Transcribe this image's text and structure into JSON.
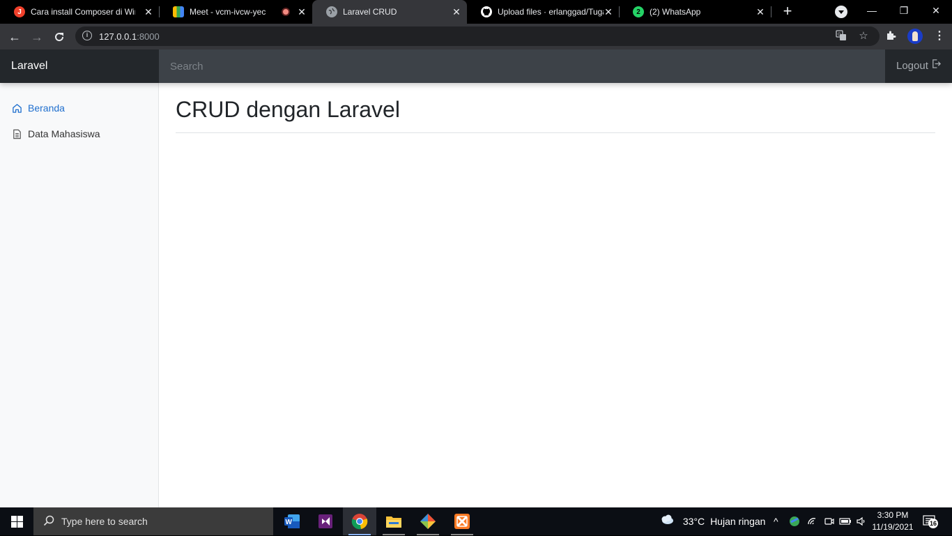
{
  "browser": {
    "tabs": [
      {
        "title": "Cara install Composer di Wind",
        "favicon": "jotform-icon",
        "color": "#f1402b",
        "glyph": "J"
      },
      {
        "title": "Meet - vcm-ivcw-yec",
        "favicon": "google-meet-icon",
        "color": "#00832d",
        "glyph": "■"
      },
      {
        "title": "Laravel CRUD",
        "favicon": "globe-icon",
        "color": "#9aa0a6",
        "glyph": "●"
      },
      {
        "title": "Upload files · erlanggad/Tuga",
        "favicon": "github-icon",
        "color": "#ffffff",
        "glyph": "●"
      },
      {
        "title": "(2) WhatsApp",
        "favicon": "whatsapp-icon",
        "color": "#25d366",
        "glyph": "2"
      }
    ],
    "url_host": "127.0.0.1",
    "url_port": ":8000"
  },
  "app": {
    "brand": "Laravel",
    "search_placeholder": "Search",
    "logout_label": "Logout",
    "sidebar": [
      {
        "label": "Beranda",
        "icon": "home-icon",
        "active": true
      },
      {
        "label": "Data Mahasiswa",
        "icon": "document-icon",
        "active": false
      }
    ],
    "page_title": "CRUD dengan Laravel"
  },
  "taskbar": {
    "search_placeholder": "Type here to search",
    "apps": [
      "word-icon",
      "visual-studio-icon",
      "chrome-icon",
      "file-explorer-icon",
      "git-icon",
      "xampp-icon"
    ],
    "weather_temp": "33°C",
    "weather_desc": "Hujan ringan",
    "time": "3:30 PM",
    "date": "11/19/2021",
    "notification_count": "16"
  }
}
